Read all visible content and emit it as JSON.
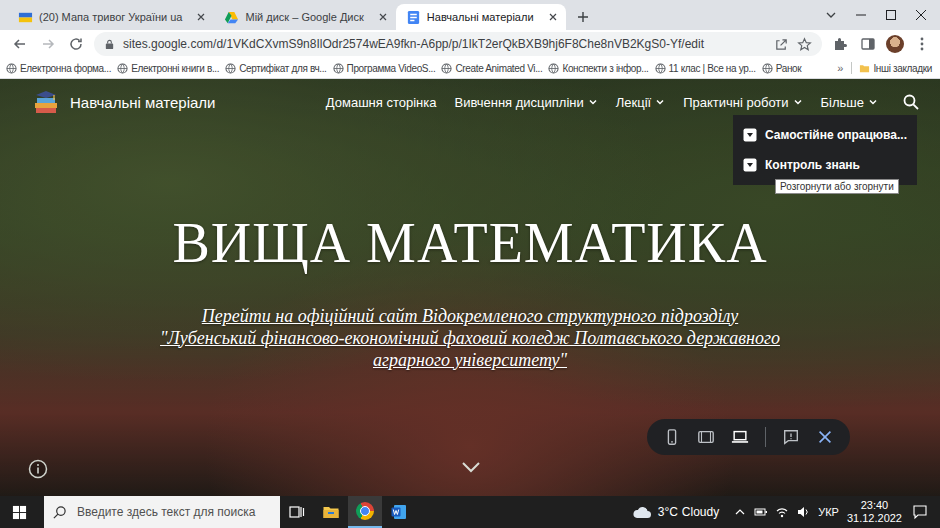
{
  "browser": {
    "tabs": [
      {
        "label": "(20) Мапа тривог України ua",
        "kind": "alerts",
        "selected": false
      },
      {
        "label": "Мій диск – Google Диск",
        "kind": "drive",
        "selected": false
      },
      {
        "label": "Навчальні матеріали",
        "kind": "sites",
        "selected": true
      }
    ],
    "address": "sites.google.com/d/1VKdCXvmS9n8IlOdr2574wEA9fkn-A6pp/p/1IkT2erQkBXB9hj6F8Che8nVB2KgS0-Yf/edit",
    "bookmarks": [
      "Електронна форма...",
      "Електронні книги в...",
      "Сертифікат для вч...",
      "Программа VideoS...",
      "Create Animated Vi...",
      "Конспекти з інфор...",
      "11 клас | Все на ур...",
      "Ранок"
    ],
    "bookmarks_overflow": "»",
    "other_bookmarks": "Інші закладки"
  },
  "site": {
    "title": "Навчальні матеріали",
    "nav": [
      {
        "label": "Домашня сторінка",
        "dropdown": false
      },
      {
        "label": "Вивчення дисципліни",
        "dropdown": true
      },
      {
        "label": "Лекції",
        "dropdown": true
      },
      {
        "label": "Практичні роботи",
        "dropdown": true
      },
      {
        "label": "Більше",
        "dropdown": true
      }
    ],
    "more_menu": [
      {
        "label": "Самостійне опрацюва...",
        "expanded": false
      },
      {
        "label": "Контроль знань",
        "expanded": false
      }
    ],
    "tooltip": "Розгорнути або згорнути",
    "hero_title": "ВИЩА МАТЕМАТИКА",
    "hero_link": [
      "Перейти на офіційний сайт Відокремленого структурного підрозділу",
      "\"Лубенський фінансово-економічний фаховий коледж Полтавського державного",
      "аграрного університету\""
    ]
  },
  "preview_toolbar": [
    {
      "kind": "phone",
      "selected": false
    },
    {
      "kind": "tablet",
      "selected": false
    },
    {
      "kind": "laptop",
      "selected": true
    },
    {
      "kind": "feedback",
      "selected": false
    },
    {
      "kind": "close",
      "selected": false
    }
  ],
  "taskbar": {
    "search_placeholder": "Введите здесь текст для поиска",
    "apps": [
      {
        "kind": "folder",
        "active": false
      },
      {
        "kind": "chrome",
        "active": true
      },
      {
        "kind": "word",
        "active": false
      }
    ],
    "weather": {
      "temperature": "3°C",
      "condition": "Cloudy"
    },
    "language": "УКР",
    "time": "23:40",
    "date": "31.12.2022"
  }
}
